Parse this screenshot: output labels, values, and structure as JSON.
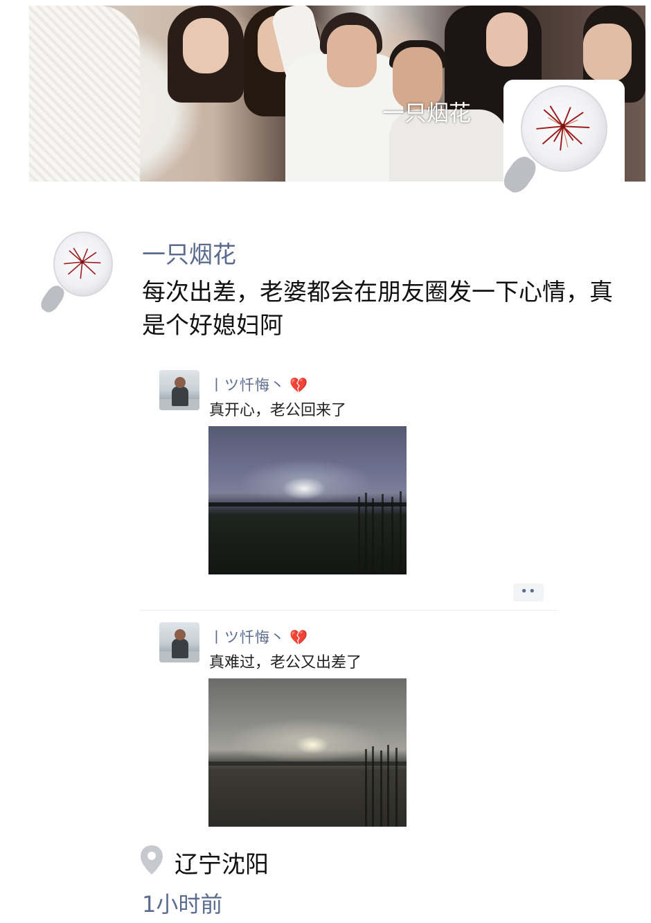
{
  "cover": {
    "name": "一只烟花"
  },
  "post": {
    "author": "一只烟花",
    "text": "每次出差，老婆都会在朋友圈发一下心情，真是个好媳妇阿",
    "location": "辽宁沈阳",
    "time": "1小时前"
  },
  "shared_posts": [
    {
      "author": "丨ツ忏悔丶",
      "heart": "💔",
      "text": "真开心，老公回来了"
    },
    {
      "author": "丨ツ忏悔丶",
      "heart": "💔",
      "text": "真难过，老公又出差了"
    }
  ],
  "more_button": "••",
  "icons": [
    "location-pin-icon",
    "broken-heart-icon",
    "more-icon"
  ],
  "colors": {
    "link_blue": "#5b6b8f",
    "text": "#111111",
    "heart": "#d0304b"
  }
}
